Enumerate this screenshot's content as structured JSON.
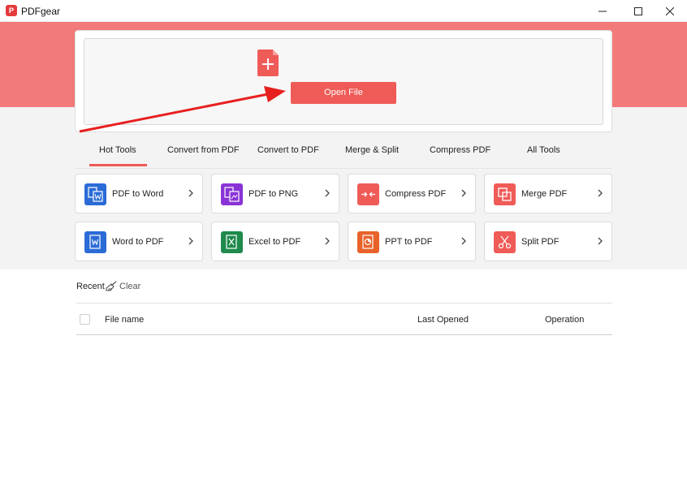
{
  "window": {
    "title": "PDFgear",
    "logo_glyph": "P",
    "controls": [
      "minimize-icon",
      "maximize-icon",
      "close-icon"
    ]
  },
  "colors": {
    "accent": "#ef5b57",
    "header_band": "#f37a7a",
    "arrow": "#e81f1f"
  },
  "open": {
    "icon": "add-file-icon",
    "button_label": "Open File"
  },
  "tabs": [
    {
      "label": "Hot Tools",
      "selected": true
    },
    {
      "label": "Convert from PDF",
      "selected": false
    },
    {
      "label": "Convert to PDF",
      "selected": false
    },
    {
      "label": "Merge & Split",
      "selected": false
    },
    {
      "label": "Compress PDF",
      "selected": false
    },
    {
      "label": "All Tools",
      "selected": false
    }
  ],
  "tools": [
    {
      "label": "PDF to Word",
      "icon": "pdf-to-word-icon",
      "color": "#2b6bd6"
    },
    {
      "label": "PDF to PNG",
      "icon": "pdf-to-png-icon",
      "color": "#8a33d6"
    },
    {
      "label": "Compress PDF",
      "icon": "compress-icon",
      "color": "#ef5b57"
    },
    {
      "label": "Merge PDF",
      "icon": "merge-icon",
      "color": "#ef5b57"
    },
    {
      "label": "Word to PDF",
      "icon": "word-to-pdf-icon",
      "color": "#2b6bd6"
    },
    {
      "label": "Excel to PDF",
      "icon": "excel-to-pdf-icon",
      "color": "#1e8a4c"
    },
    {
      "label": "PPT to PDF",
      "icon": "ppt-to-pdf-icon",
      "color": "#e8622a"
    },
    {
      "label": "Split PDF",
      "icon": "scissors-icon",
      "color": "#ef5b57"
    }
  ],
  "recent": {
    "label": "Recent",
    "clear_icon": "broom-icon",
    "clear_label": "Clear",
    "columns": [
      "File name",
      "Last Opened",
      "Operation"
    ]
  }
}
